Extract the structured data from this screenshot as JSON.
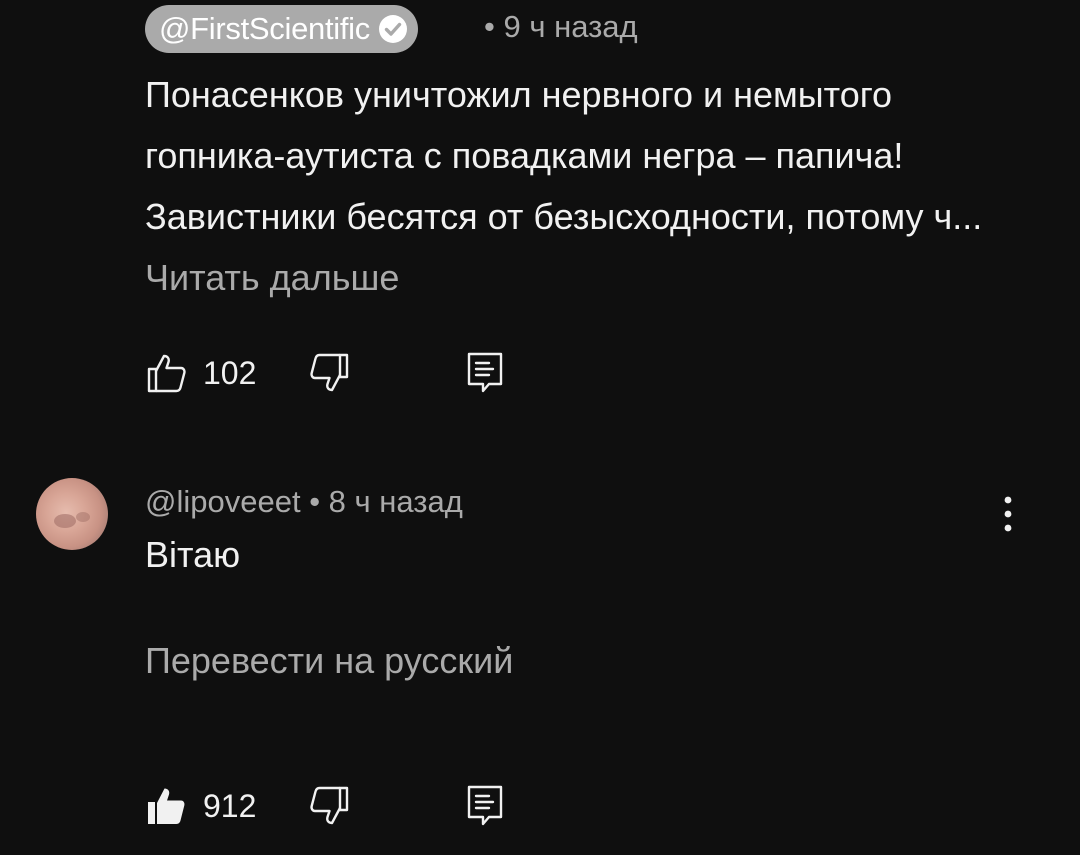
{
  "comments": [
    {
      "author": "@FirstScientific",
      "verified": true,
      "meta": "• 9 ч назад",
      "text": "Понасенков уничтожил нервного и немытого гопника-аутиста с повадками негра – папича! Завистники бесятся от безысходности, потому ч...",
      "read_more": "Читать дальше",
      "likes": "102",
      "liked": false
    },
    {
      "author": "@lipoveeet",
      "meta": "• 8 ч назад",
      "text": "Вітаю",
      "translate": "Перевести на русский",
      "likes": "912",
      "liked": true
    }
  ],
  "icons": {
    "like": "thumbs-up-icon",
    "dislike": "thumbs-down-icon",
    "reply": "reply-comment-icon",
    "more": "more-vertical-icon",
    "verified": "verified-check-icon"
  },
  "colors": {
    "background": "#0f0f0f",
    "text_primary": "#f1f1f1",
    "text_secondary": "#aaaaaa",
    "author_pill": "#aaaaaa"
  }
}
